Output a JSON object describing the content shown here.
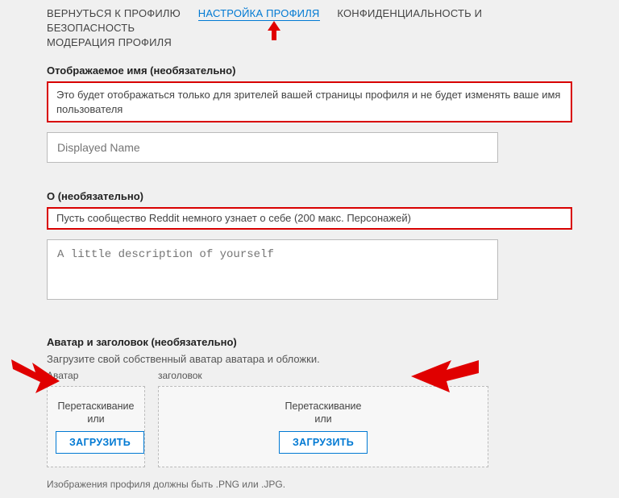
{
  "tabs": {
    "back": "ВЕРНУТЬСЯ К ПРОФИЛЮ",
    "settings": "НАСТРОЙКА ПРОФИЛЯ",
    "privacy": "КОНФИДЕНЦИАЛЬНОСТЬ И БЕЗОПАСНОСТЬ",
    "moderation": "МОДЕРАЦИЯ ПРОФИЛЯ"
  },
  "displayName": {
    "label": "Отображаемое имя (необязательно)",
    "help": "Это будет отображаться только для зрителей вашей страницы профиля и не будет изменять ваше имя пользователя",
    "placeholder": "Displayed Name"
  },
  "about": {
    "label": "О (необязательно)",
    "help": "Пусть сообщество Reddit немного узнает о себе (200 макс. Персонажей)",
    "placeholder": "A little description of yourself"
  },
  "avatar": {
    "label": "Аватар и заголовок (необязательно)",
    "sub": "Загрузите свой собственный аватар аватара и обложки.",
    "colAvatar": "Аватар",
    "colHeader": "заголовок",
    "drag": "Перетаскивание",
    "or": "или",
    "uploadBtn": "ЗАГРУЗИТЬ",
    "note": "Изображения профиля должны быть .PNG или .JPG."
  }
}
